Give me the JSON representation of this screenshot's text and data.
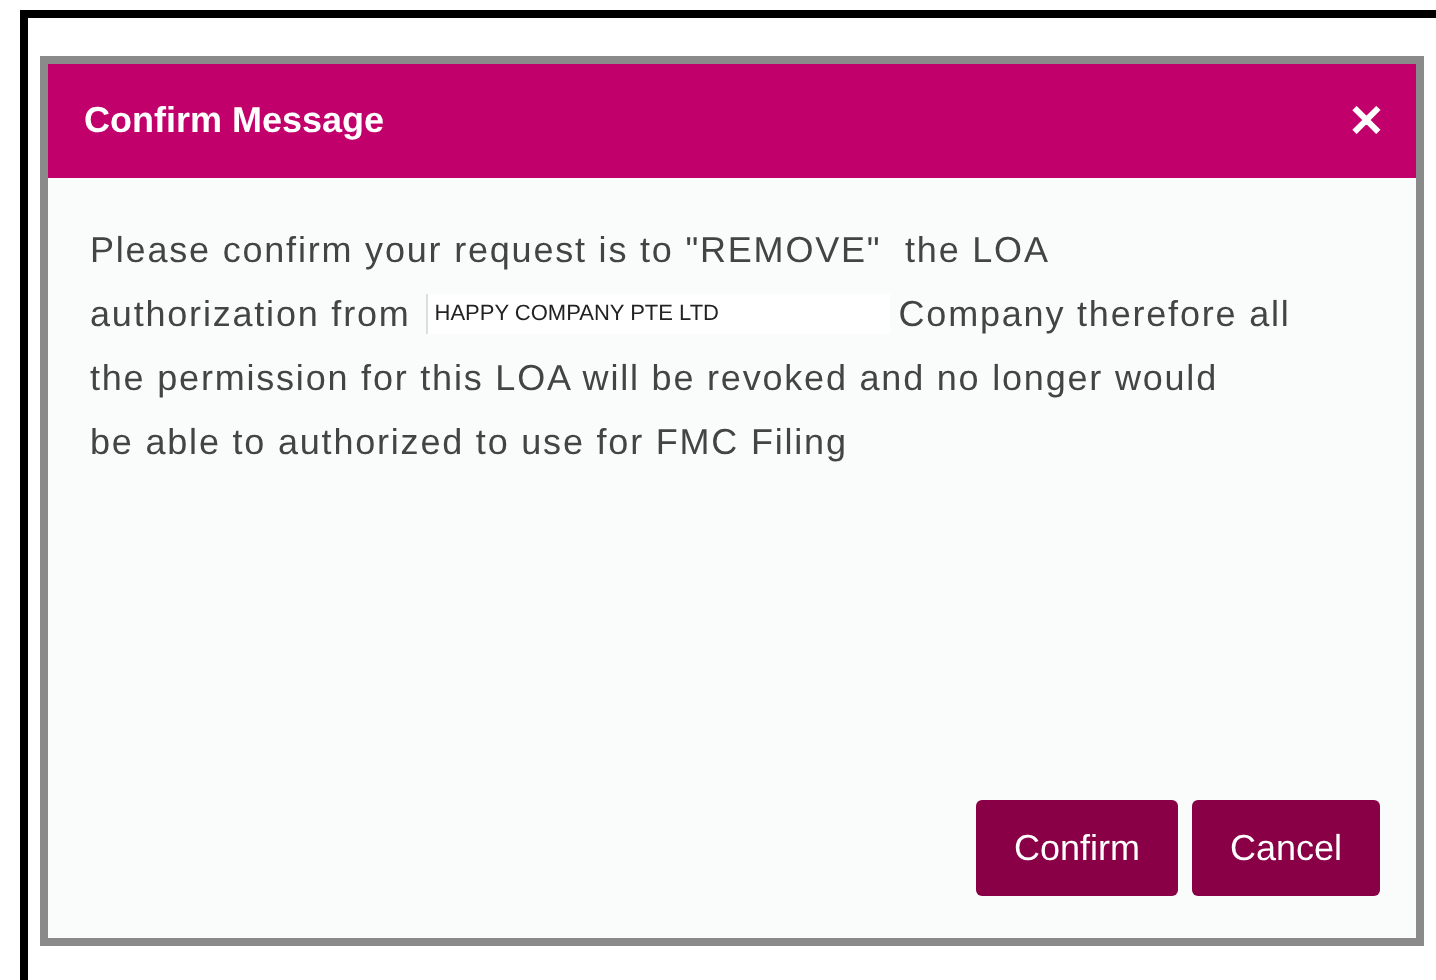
{
  "dialog": {
    "title": "Confirm Message",
    "close": "✕",
    "message_lines": [
      {
        "text": "Please confirm your request is to \"REMOVE\"  the LOA"
      },
      {
        "before": "authorization from",
        "company": "HAPPY COMPANY PTE LTD",
        "after": "Company therefore all"
      },
      {
        "text": "the permission for this LOA will be revoked and no longer would"
      },
      {
        "text": "be able to authorized to use for FMC Filing"
      }
    ],
    "buttons": [
      {
        "label": "Confirm"
      },
      {
        "label": "Cancel"
      }
    ]
  }
}
